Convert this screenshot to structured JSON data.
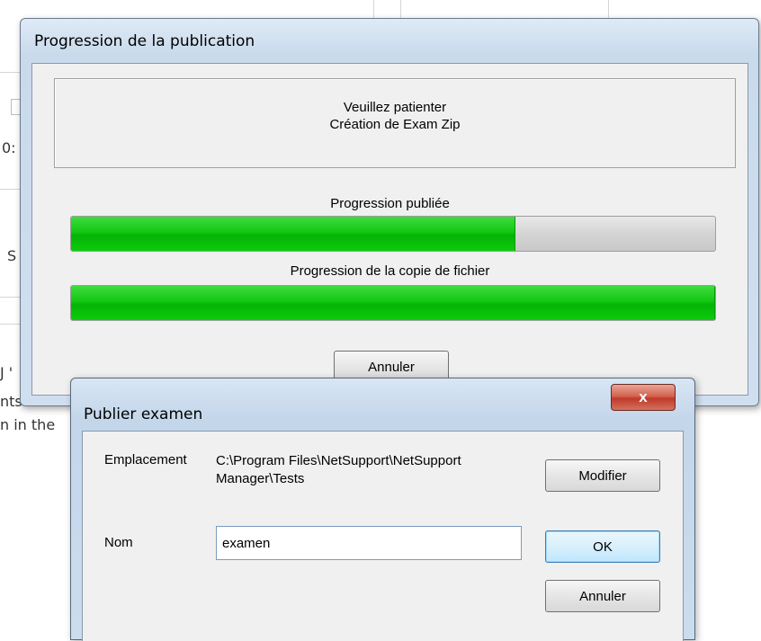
{
  "background": {
    "fragments": [
      "0:",
      "S",
      "J '",
      "nts true",
      "n in the"
    ]
  },
  "progress_window": {
    "title": "Progression de la publication",
    "message_line1": "Veuillez patienter",
    "message_line2": "Création de Exam Zip",
    "publish_progress": {
      "label": "Progression publiée",
      "value": 0.69
    },
    "copy_progress": {
      "label": "Progression de la copie de fichier",
      "value": 1.0
    },
    "cancel_label": "Annuler"
  },
  "publish_dialog": {
    "title": "Publier examen",
    "close_glyph": "x",
    "location_label": "Emplacement",
    "location_value": "C:\\Program Files\\NetSupport\\NetSupport Manager\\Tests",
    "name_label": "Nom",
    "name_value": "examen",
    "modify_label": "Modifier",
    "ok_label": "OK",
    "cancel_label": "Annuler"
  },
  "colors": {
    "progress_fill": "#12c712",
    "close_button": "#c0392b",
    "default_button_border": "#3c7fb1"
  }
}
